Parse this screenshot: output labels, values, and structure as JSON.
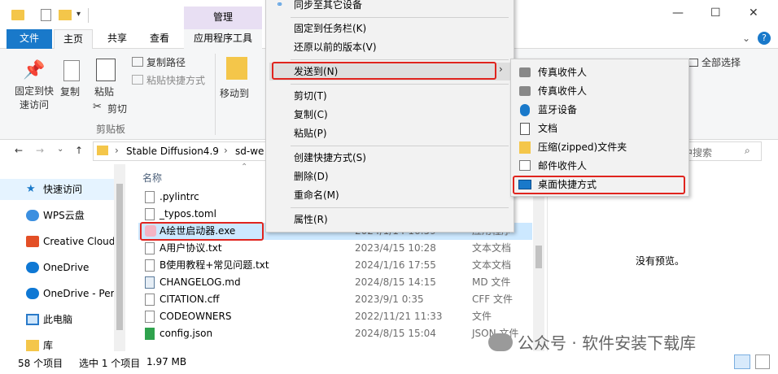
{
  "titlebar": {
    "manage_tab": "管理"
  },
  "ribbon_tabs": {
    "file": "文件",
    "home": "主页",
    "share": "共享",
    "view": "查看",
    "app_tools": "应用程序工具"
  },
  "ribbon": {
    "pin_quick_access": "固定到快速访问",
    "copy": "复制",
    "paste": "粘贴",
    "copy_path": "复制路径",
    "paste_shortcut": "粘贴快捷方式",
    "cut": "剪切",
    "clipboard_group": "剪贴板",
    "move_to": "移动到",
    "select_all_partial": "全部选择"
  },
  "address": {
    "path_1": "Stable Diffusion4.9",
    "path_2": "sd-we",
    "search_placeholder": "中搜索"
  },
  "nav": {
    "items": [
      {
        "label": "快速访问"
      },
      {
        "label": "WPS云盘"
      },
      {
        "label": "Creative Cloud"
      },
      {
        "label": "OneDrive"
      },
      {
        "label": "OneDrive - Per"
      },
      {
        "label": "此电脑"
      },
      {
        "label": "库"
      }
    ]
  },
  "files": {
    "header_name": "名称",
    "rows": [
      {
        "name": ".pylintrc",
        "date": "",
        "type": ""
      },
      {
        "name": "_typos.toml",
        "date": "",
        "type": ""
      },
      {
        "name": "A绘世启动器.exe",
        "date": "2024/1/14 16:59",
        "type": "应用程序"
      },
      {
        "name": "A用户协议.txt",
        "date": "2023/4/15 10:28",
        "type": "文本文档"
      },
      {
        "name": "B使用教程+常见问题.txt",
        "date": "2024/1/16 17:55",
        "type": "文本文档"
      },
      {
        "name": "CHANGELOG.md",
        "date": "2024/8/15 14:15",
        "type": "MD 文件"
      },
      {
        "name": "CITATION.cff",
        "date": "2023/9/1 0:35",
        "type": "CFF 文件"
      },
      {
        "name": "CODEOWNERS",
        "date": "2022/11/21 11:33",
        "type": "文件"
      },
      {
        "name": "config.json",
        "date": "2024/8/15 15:04",
        "type": "JSON 文件"
      }
    ]
  },
  "context_menu": {
    "items": [
      {
        "label": "同步至其它设备"
      },
      {
        "label": "固定到任务栏(K)"
      },
      {
        "label": "还原以前的版本(V)"
      },
      {
        "label": "发送到(N)"
      },
      {
        "label": "剪切(T)"
      },
      {
        "label": "复制(C)"
      },
      {
        "label": "粘贴(P)"
      },
      {
        "label": "创建快捷方式(S)"
      },
      {
        "label": "删除(D)"
      },
      {
        "label": "重命名(M)"
      },
      {
        "label": "属性(R)"
      }
    ]
  },
  "submenu": {
    "items": [
      {
        "label": "传真收件人"
      },
      {
        "label": "传真收件人"
      },
      {
        "label": "蓝牙设备"
      },
      {
        "label": "文档"
      },
      {
        "label": "压缩(zipped)文件夹"
      },
      {
        "label": "邮件收件人"
      },
      {
        "label": "桌面快捷方式"
      }
    ]
  },
  "preview": {
    "no_preview": "没有预览。"
  },
  "status": {
    "item_count": "58 个项目",
    "selection": "选中 1 个项目",
    "size": "1.97 MB"
  },
  "watermark": {
    "text": "公众号 · 软件安装下载库"
  },
  "colors": {
    "accent": "#1979ca",
    "highlight_red": "#e0241e",
    "selection_bg": "#cce8ff",
    "manage_tab_bg": "#e8dff3"
  }
}
